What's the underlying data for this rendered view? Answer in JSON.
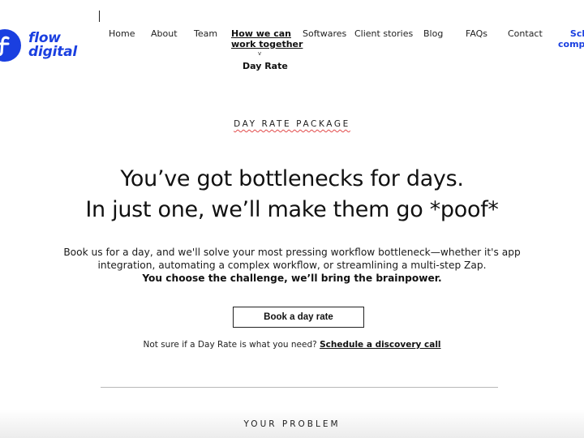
{
  "brand": {
    "name_line1": "flow",
    "name_line2": "digital",
    "logo_icon": "f-letter-circle-icon",
    "accent_color": "#1a3fe0"
  },
  "nav": {
    "items": [
      {
        "label": "Home"
      },
      {
        "label": "About"
      },
      {
        "label": "Team"
      },
      {
        "label_line1": "How we can",
        "label_line2": "work together",
        "active": true
      },
      {
        "label": "Softwares"
      },
      {
        "label": "Client stories"
      },
      {
        "label": "Blog"
      },
      {
        "label": "FAQs"
      },
      {
        "label": "Contact"
      }
    ],
    "cta_line1": "Sch",
    "cta_line2": "compl",
    "submenu_chevron": "v",
    "submenu_item": "Day Rate"
  },
  "hero": {
    "eyebrow": "DAY RATE PACKAGE",
    "headline_line1": "You’ve got bottlenecks for days.",
    "headline_line2": "In just one, we’ll make them go *poof*",
    "body_line1": "Book us for a day, and we'll solve your most pressing workflow bottleneck—whether it's app",
    "body_line2": "integration, automating a complex workflow, or streamlining a multi-step Zap.",
    "body_bold": "You choose the challenge, we’ll bring the brainpower.",
    "cta_label": "Book a day rate",
    "discovery_prefix": "Not sure if a Day Rate is what you need?",
    "discovery_link": "Schedule a discovery call"
  },
  "next_section": {
    "label": "YOUR PROBLEM"
  }
}
